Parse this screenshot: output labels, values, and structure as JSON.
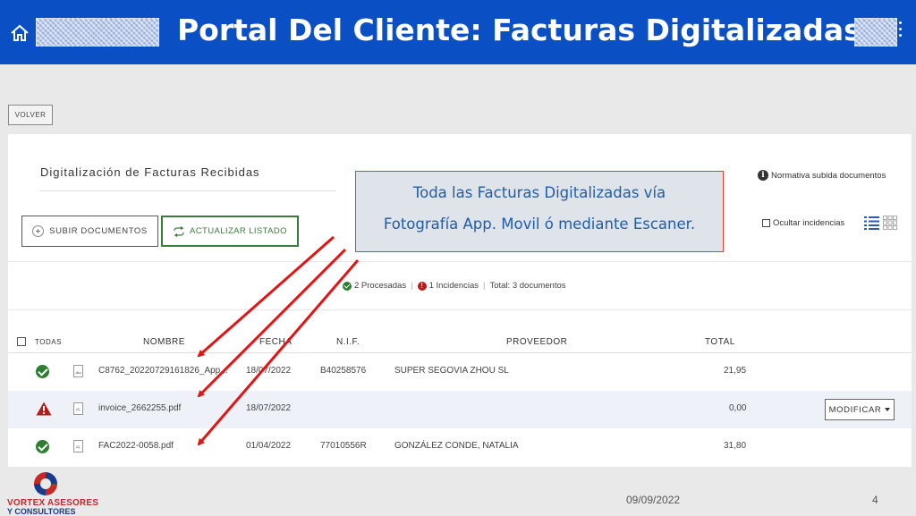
{
  "header": {
    "title": "Portal Del Cliente: Facturas Digitalizadas",
    "brand_color": "#0a4fc4"
  },
  "toolbar": {
    "back_label": "VOLVER"
  },
  "section": {
    "title": "Digitalización de Facturas Recibidas",
    "upload_label": "SUBIR DOCUMENTOS",
    "refresh_label": "ACTUALIZAR LISTADO",
    "normativa_label": "Normativa subida documentos",
    "hide_issues_label": "Ocultar incidencias"
  },
  "callout": {
    "line1": "Toda las Facturas Digitalizadas vía",
    "line2": "Fotografía App. Movil ó mediante Escaner."
  },
  "summary": {
    "processed": "2 Procesadas",
    "issues": "1 Incidencias",
    "total": "Total: 3 documentos"
  },
  "table": {
    "headers": {
      "all": "TODAS",
      "name": "NOMBRE",
      "date": "FECHA",
      "nif": "N.I.F.",
      "supplier": "PROVEEDOR",
      "total": "TOTAL"
    },
    "rows": [
      {
        "status": "ok",
        "icon": "image-file-icon",
        "name": "C8762_20220729161826_App...",
        "date": "18/07/2022",
        "nif": "B40258576",
        "supplier": "SUPER SEGOVIA ZHOU SL",
        "total": "21,95"
      },
      {
        "status": "warning",
        "icon": "pdf-file-icon",
        "name": "invoice_2662255.pdf",
        "date": "18/07/2022",
        "nif": "",
        "supplier": "",
        "total": "0,00",
        "action": "MODIFICAR"
      },
      {
        "status": "ok",
        "icon": "pdf-file-icon",
        "name": "FAC2022-0058.pdf",
        "date": "01/04/2022",
        "nif": "77010556R",
        "supplier": "GONZÁLEZ CONDE, NATALIA",
        "total": "31,80"
      }
    ]
  },
  "footer": {
    "logo_line1": "VORTEX ASESORES",
    "logo_line2": "Y CONSULTORES",
    "date": "09/09/2022",
    "page": "4"
  },
  "colors": {
    "success": "#2e7d32",
    "error": "#b71c1c",
    "arrow": "#e01515",
    "callout_text": "#1f5da8"
  }
}
